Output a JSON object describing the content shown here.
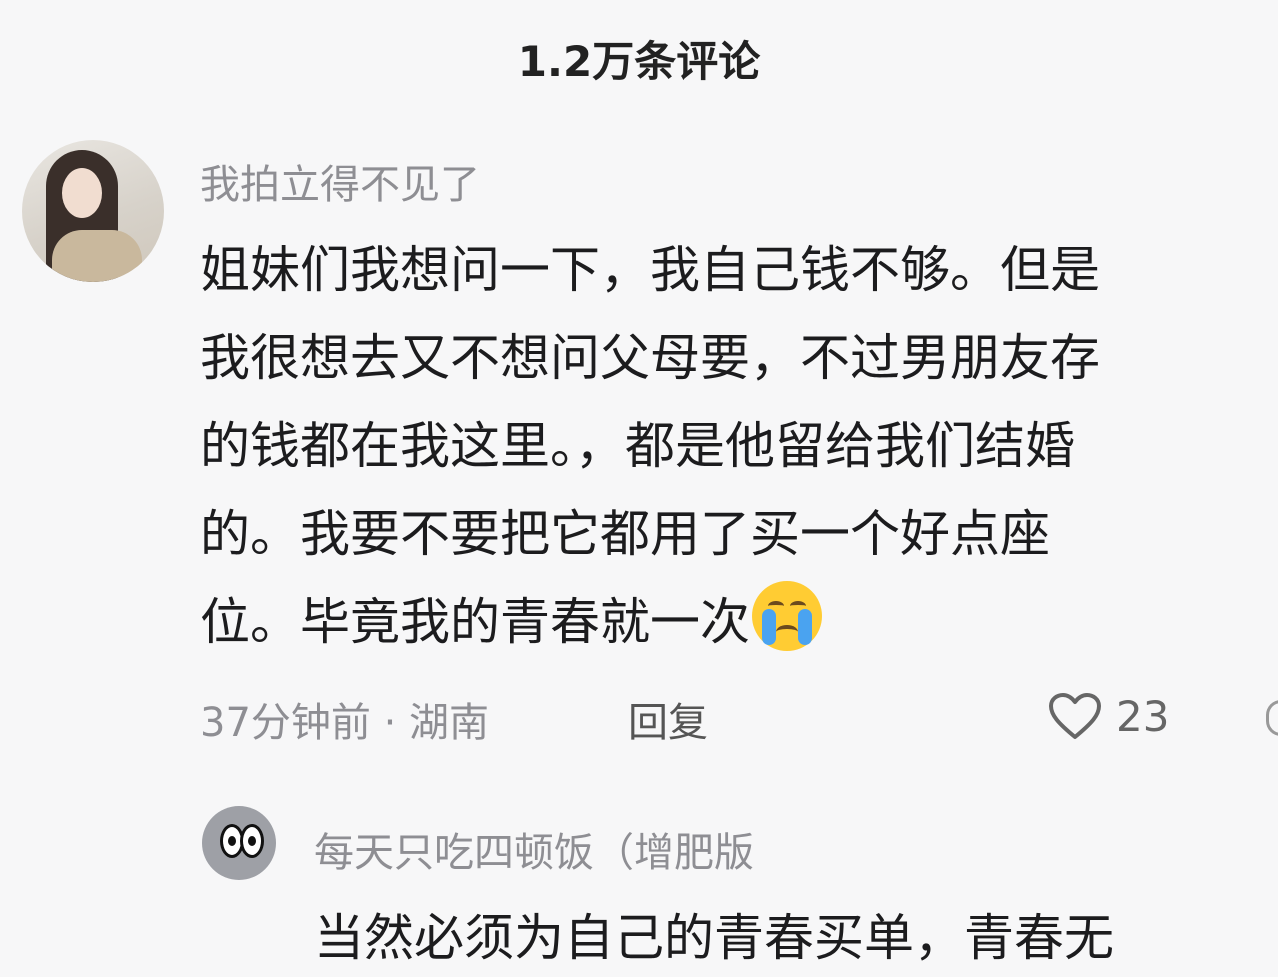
{
  "header": {
    "title": "1.2万条评论"
  },
  "comment": {
    "username": "我拍立得不见了",
    "lines": [
      "姐妹们我想问一下，我自己钱不够。但是",
      "我很想去又不想问父母要，不过男朋友存",
      "的钱都在我这里。，都是他留给我们结婚",
      "的。我要不要把它都用了买一个好点座",
      "位。毕竟我的青春就一次"
    ],
    "emoji": "crying-face",
    "meta": "37分钟前 · 湖南",
    "reply_label": "回复",
    "like_count": "23"
  },
  "reply": {
    "username": "每天只吃四顿饭（增肥版",
    "text": "当然必须为自己的青春买单，青春无"
  },
  "colors": {
    "background": "#f7f7f8",
    "secondary_text": "#8e8e93",
    "primary_text": "#1c1c1e"
  }
}
